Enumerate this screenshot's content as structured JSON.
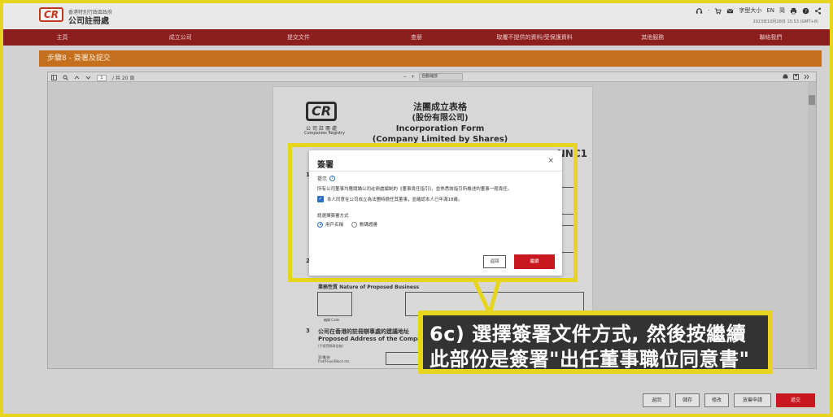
{
  "header": {
    "logo_abbr": "CR",
    "gov_line": "香港特別行政區政府",
    "org_name": "公司註冊處",
    "font_size_label": "字型大小",
    "lang_en": "EN",
    "lang_sc": "简",
    "date": "2023年10月28日 15:53 (GMT+8)"
  },
  "nav": {
    "items": [
      "主頁",
      "成立公司",
      "提交文件",
      "查册",
      "取覆不提供的資料/受保護資料",
      "其他服務",
      "聯絡我們"
    ]
  },
  "step": {
    "title": "步驟8 - 簽署及提交"
  },
  "viewer": {
    "page_no": "1",
    "page_total": "/ 共 20 頁",
    "zoom": "自動縮放",
    "minus": "−",
    "plus": "+"
  },
  "pdf_page": {
    "cr_logo": "CR",
    "cr_zh": "公司註冊處",
    "cr_en": "Companies Registry",
    "title_zh1": "法團成立表格",
    "title_zh2": "(股份有限公司)",
    "title_en1": "Incorporation Form",
    "title_en2": "(Company Limited by Shares)",
    "form_no": "NNC1",
    "sec1": "1",
    "sec2": "2",
    "sec3": "3",
    "nature_label": "業務性質 Nature of Proposed Business",
    "code_label": "編碼 Code",
    "sec3_zh": "公司在香港的註冊辦事處的建議地址",
    "sec3_en": "Proposed Address of the Company's",
    "sec3_note": "(不接受郵政信箱)",
    "flat_label": "室/樓/座\nFlat/Floor/Block etc."
  },
  "modal": {
    "title": "簽署",
    "close": "×",
    "hint_label": "提示",
    "desc": "所有公司董事均應閱讀公司註冊處編制的《董事責任指引》，並熟悉該指引所概述的董事一般責任。",
    "check_label": "本人同意在公司成立為法團時擔任其董事，並確認本人已年滿18歲。",
    "select_label": "請選擇簽署方式",
    "options": [
      "用戶名稱",
      "數碼證書"
    ],
    "selected": "用戶名稱",
    "back": "返回",
    "continue": "繼續"
  },
  "callout": {
    "line1": "6c) 選擇簽署文件方式, 然後按繼續",
    "line2": "此部份是簽署\"出任董事職位同意書\""
  },
  "bottom": {
    "buttons": [
      "返回",
      "儲存",
      "修改",
      "放棄申請",
      "遞交"
    ]
  },
  "colors": {
    "highlight": "#e6d41f",
    "nav_bg": "#8c1e1e",
    "step_bg": "#c4701e",
    "primary_red": "#c8171f",
    "accent_blue": "#2a6fc4"
  }
}
